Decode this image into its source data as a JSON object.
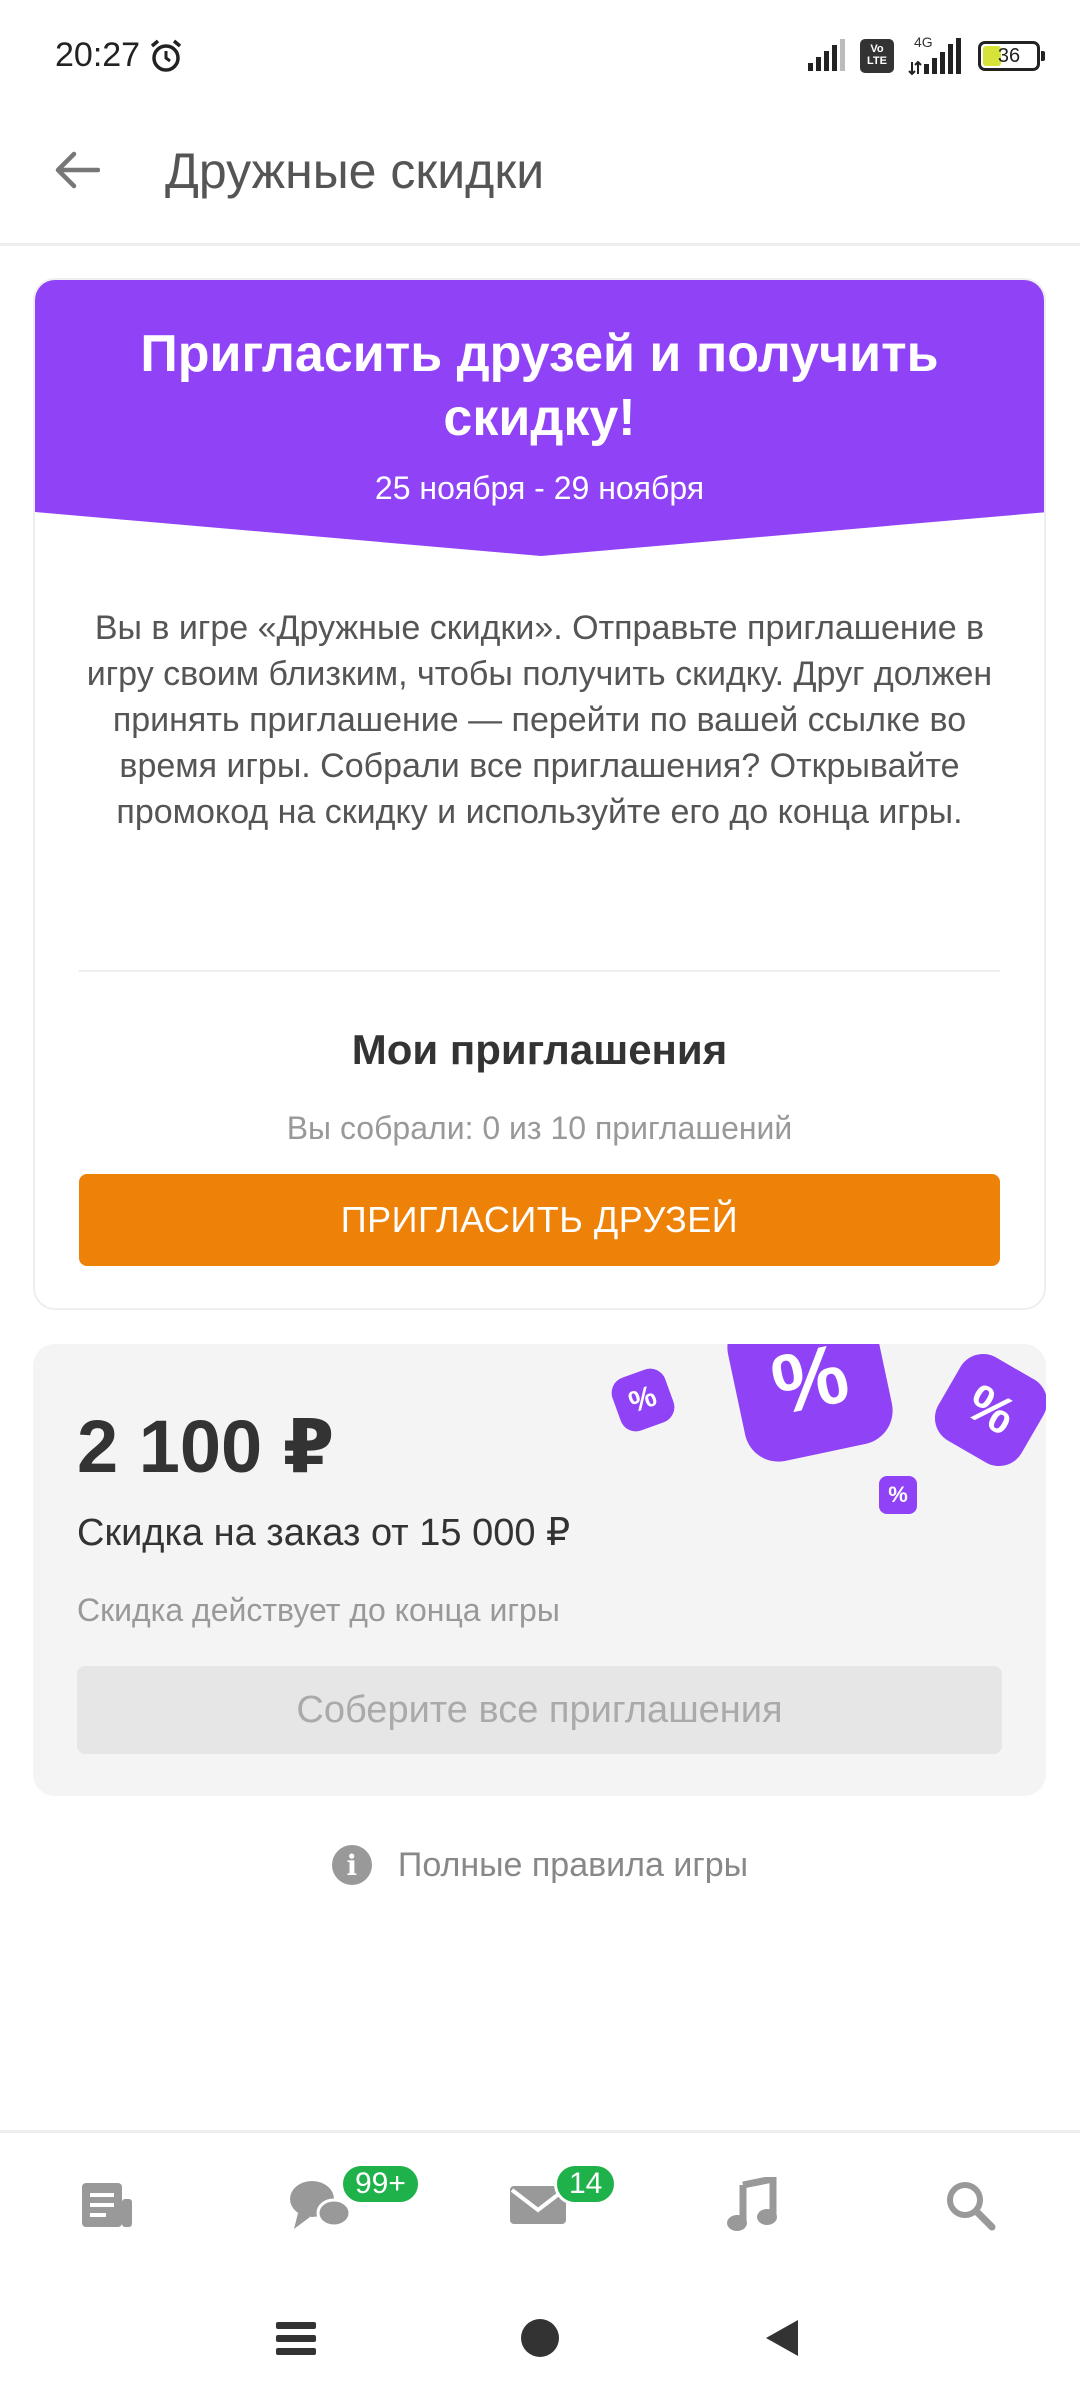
{
  "status_bar": {
    "time": "20:27",
    "battery": "36",
    "network": "4G",
    "volte": "Vo LTE"
  },
  "header": {
    "title": "Дружные скидки"
  },
  "promo": {
    "headline": "Пригласить друзей и получить скидку!",
    "dates": "25 ноября - 29 ноября",
    "description": "Вы в игре «Дружные скидки». Отправьте приглашение в игру своим близким, чтобы получить скидку. Друг должен принять приглашение — перейти по вашей ссылке во время игры. Собрали все приглашения? Открывайте промокод на скидку и используйте его до конца игры.",
    "invitations_title": "Мои приглашения",
    "invitations_count": "Вы собрали: 0 из 10 приглашений",
    "invite_button": "ПРИГЛАСИТЬ ДРУЗЕЙ"
  },
  "discount": {
    "amount": "2 100 ₽",
    "condition": "Скидка на заказ от 15 000 ₽",
    "validity": "Скидка действует до конца игры",
    "collect_button": "Соберите все приглашения",
    "badge_symbol": "%"
  },
  "rules": {
    "link_text": "Полные правила игры"
  },
  "bottom_nav": {
    "items": [
      {
        "name": "feed-icon"
      },
      {
        "name": "discussions-icon",
        "badge": "99+"
      },
      {
        "name": "messages-icon",
        "badge": "14"
      },
      {
        "name": "music-icon"
      },
      {
        "name": "search-icon"
      }
    ]
  },
  "colors": {
    "accent_purple": "#9043f6",
    "accent_orange": "#ee8208",
    "badge_green": "#1fb14a"
  }
}
